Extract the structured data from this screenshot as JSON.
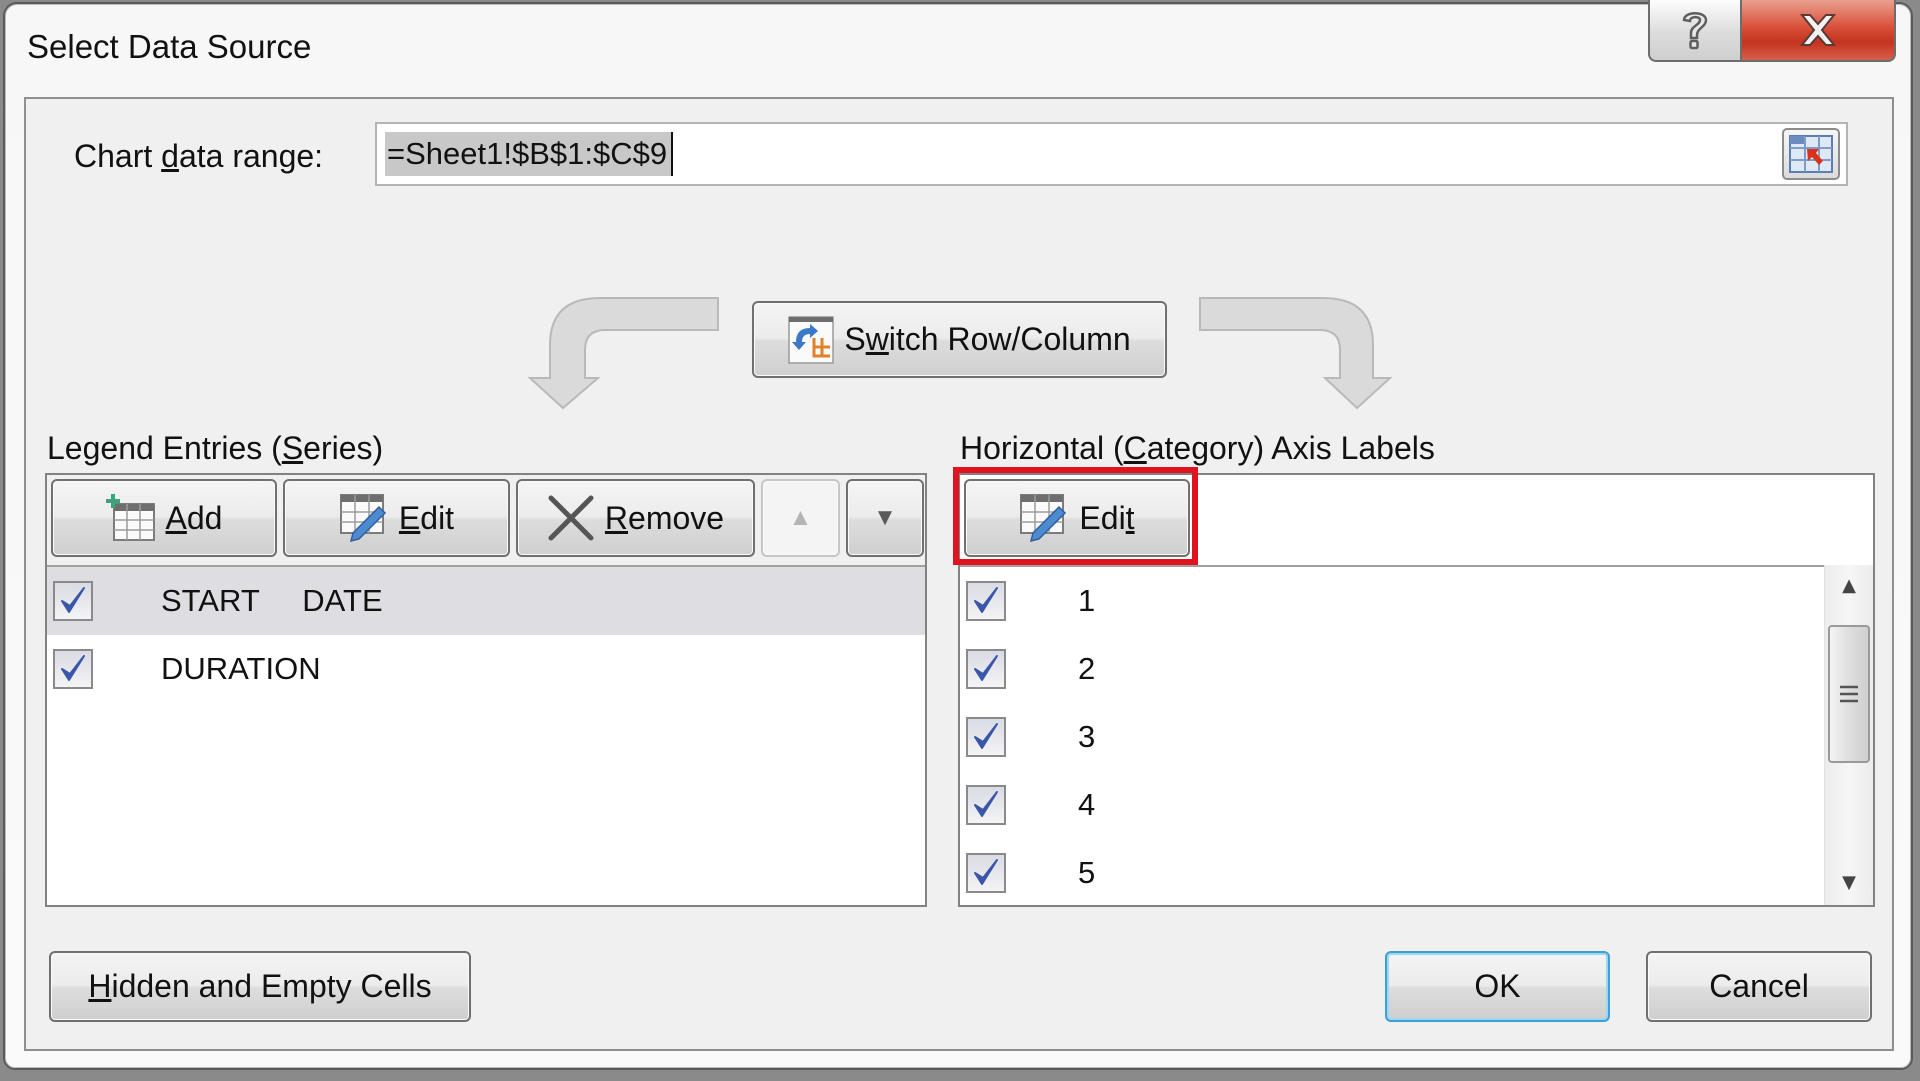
{
  "dialog": {
    "title": "Select Data Source",
    "help_tooltip": "?",
    "close_symbol": "✕"
  },
  "chart_range": {
    "label_pre": "Chart ",
    "label_accel": "d",
    "label_post": "ata range:",
    "value": "=Sheet1!$B$1:$C$9",
    "picker_icon": "range-picker-icon"
  },
  "switch_button": {
    "label_pre": "S",
    "label_accel": "w",
    "label_post": "itch Row/Column"
  },
  "legend": {
    "heading_pre": "Legend Entries (",
    "heading_accel": "S",
    "heading_post": "eries)",
    "toolbar": {
      "add": {
        "accel": "A",
        "rest": "dd"
      },
      "edit": {
        "accel": "E",
        "rest": "dit"
      },
      "remove": {
        "accel": "R",
        "rest": "emove"
      },
      "move_up": "▲",
      "move_down": "▼"
    },
    "series": [
      {
        "name": "START     DATE",
        "checked": true,
        "selected": true
      },
      {
        "name": "DURATION",
        "checked": true,
        "selected": false
      }
    ]
  },
  "category": {
    "heading_pre": "Horizontal (",
    "heading_accel": "C",
    "heading_post": "ategory) Axis Labels",
    "edit": {
      "pre": "Edi",
      "accel": "t"
    },
    "labels": [
      {
        "value": "1",
        "checked": true
      },
      {
        "value": "2",
        "checked": true
      },
      {
        "value": "3",
        "checked": true
      },
      {
        "value": "4",
        "checked": true
      },
      {
        "value": "5",
        "checked": true
      }
    ],
    "scroll_up": "▲",
    "scroll_down": "▼"
  },
  "footer": {
    "hidden_cells": {
      "accel": "H",
      "rest": "idden and Empty Cells"
    },
    "ok": "OK",
    "cancel": "Cancel"
  },
  "colors": {
    "highlight": "#e0141e",
    "close_button": "#d9503a",
    "check_mark": "#3b56a8",
    "ok_focus": "#3c9fd6"
  }
}
